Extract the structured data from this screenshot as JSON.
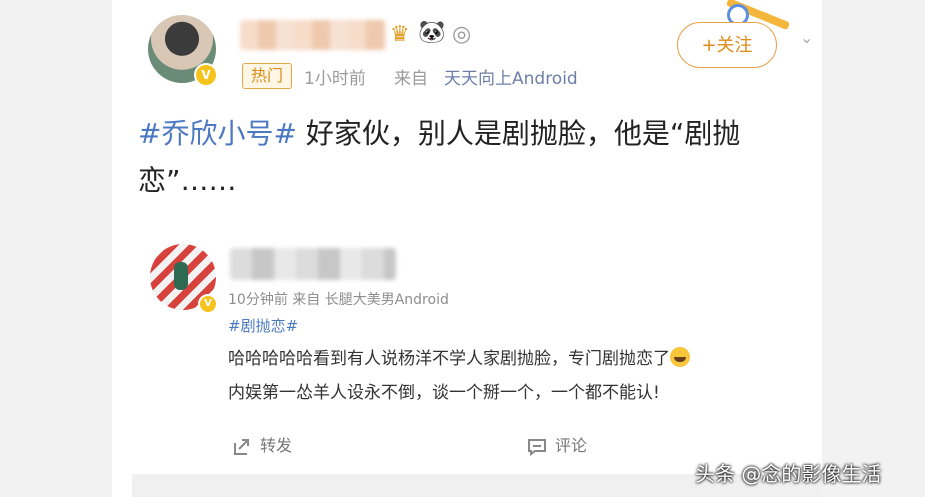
{
  "post": {
    "badge": "热门",
    "time": "1小时前",
    "from_label": "来自",
    "source": "天天向上Android",
    "follow_label": "+关注",
    "hashtag": "#乔欣小号#",
    "body": " 好家伙，别人是剧抛脸，他是“剧抛恋”……"
  },
  "comment": {
    "meta": "10分钟前  来自 长腿大美男Android",
    "hashtag": "#剧抛恋#",
    "line1": "哈哈哈哈哈看到有人说杨洋不学人家剧抛脸，专门剧抛恋了",
    "line2": "内娱第一怂羊人设永不倒，谈一个掰一个，一个都不能认!",
    "repost_label": "转发",
    "comment_label": "评论"
  },
  "watermark": "头条 @念的影像生活",
  "icons": [
    "verified-badge-icon",
    "crown-icon",
    "panda-icon",
    "medal-icon",
    "share-icon",
    "comment-icon",
    "emoji-laugh-icon",
    "chevron-down-icon"
  ]
}
